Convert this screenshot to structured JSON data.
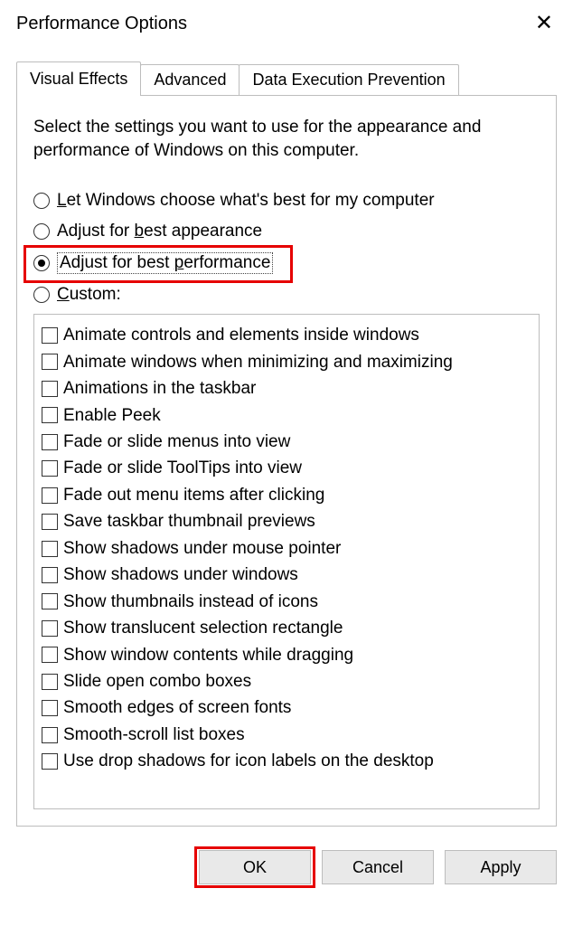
{
  "window": {
    "title": "Performance Options"
  },
  "tabs": {
    "visual_effects": "Visual Effects",
    "advanced": "Advanced",
    "dep": "Data Execution Prevention"
  },
  "intro": "Select the settings you want to use for the appearance and performance of Windows on this computer.",
  "radios": {
    "let_windows_pre": "L",
    "let_windows_post": "et Windows choose what's best for my computer",
    "best_appearance_pre": "Adjust for ",
    "best_appearance_ul": "b",
    "best_appearance_post": "est appearance",
    "best_perf_pre": "Adjust for best ",
    "best_perf_ul": "p",
    "best_perf_post": "erformance",
    "custom_ul": "C",
    "custom_post": "ustom:"
  },
  "checks": {
    "c0": "Animate controls and elements inside windows",
    "c1": "Animate windows when minimizing and maximizing",
    "c2": "Animations in the taskbar",
    "c3": "Enable Peek",
    "c4": "Fade or slide menus into view",
    "c5": "Fade or slide ToolTips into view",
    "c6": "Fade out menu items after clicking",
    "c7": "Save taskbar thumbnail previews",
    "c8": "Show shadows under mouse pointer",
    "c9": "Show shadows under windows",
    "c10": "Show thumbnails instead of icons",
    "c11": "Show translucent selection rectangle",
    "c12": "Show window contents while dragging",
    "c13": "Slide open combo boxes",
    "c14": "Smooth edges of screen fonts",
    "c15": "Smooth-scroll list boxes",
    "c16": "Use drop shadows for icon labels on the desktop"
  },
  "buttons": {
    "ok": "OK",
    "cancel": "Cancel",
    "apply": "Apply"
  }
}
